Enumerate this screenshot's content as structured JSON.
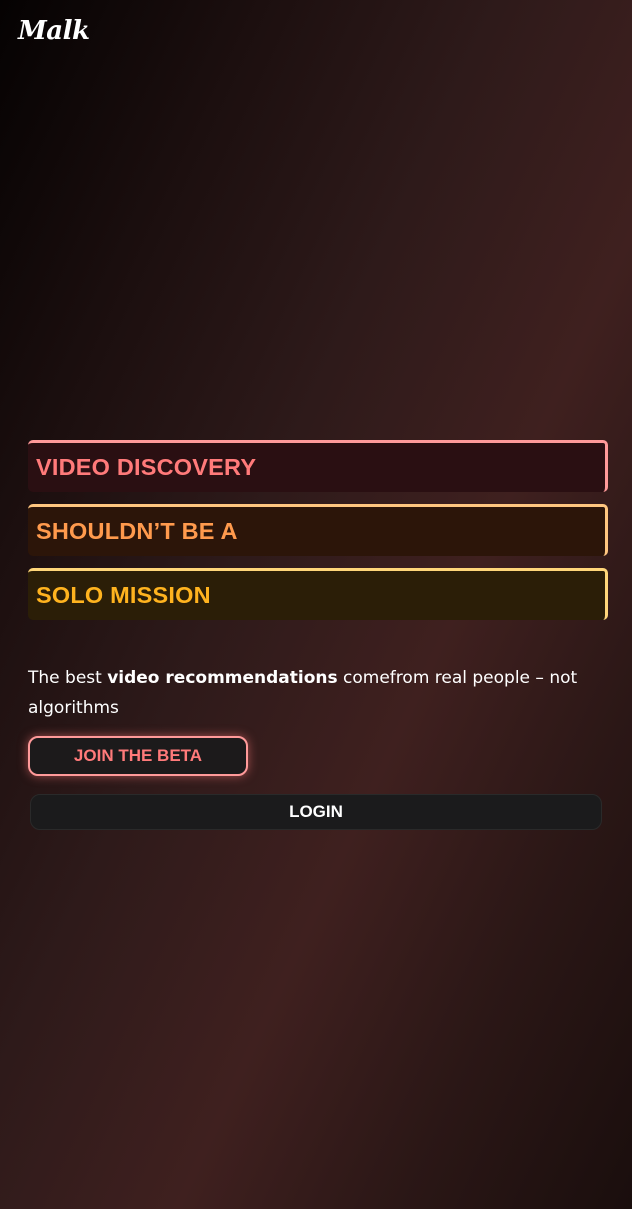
{
  "brand": {
    "logo": "Malk"
  },
  "hero": {
    "lines": [
      {
        "text": "VIDEO DISCOVERY",
        "color": "#ff7a7a"
      },
      {
        "text": "SHOULDN’T BE A",
        "color": "#ff9a4d"
      },
      {
        "text": "SOLO MISSION",
        "color": "#ffb31f"
      }
    ],
    "tagline": {
      "prefix": "The best ",
      "bold": "video recommendations",
      "suffix": " comefrom real people – not algorithms"
    }
  },
  "actions": {
    "join_beta_label": "JOIN THE BETA",
    "login_label": "LOGIN"
  },
  "colors": {
    "accent_pink": "#ff7a7a",
    "accent_orange": "#ff9a4d",
    "accent_yellow": "#ffb31f"
  }
}
